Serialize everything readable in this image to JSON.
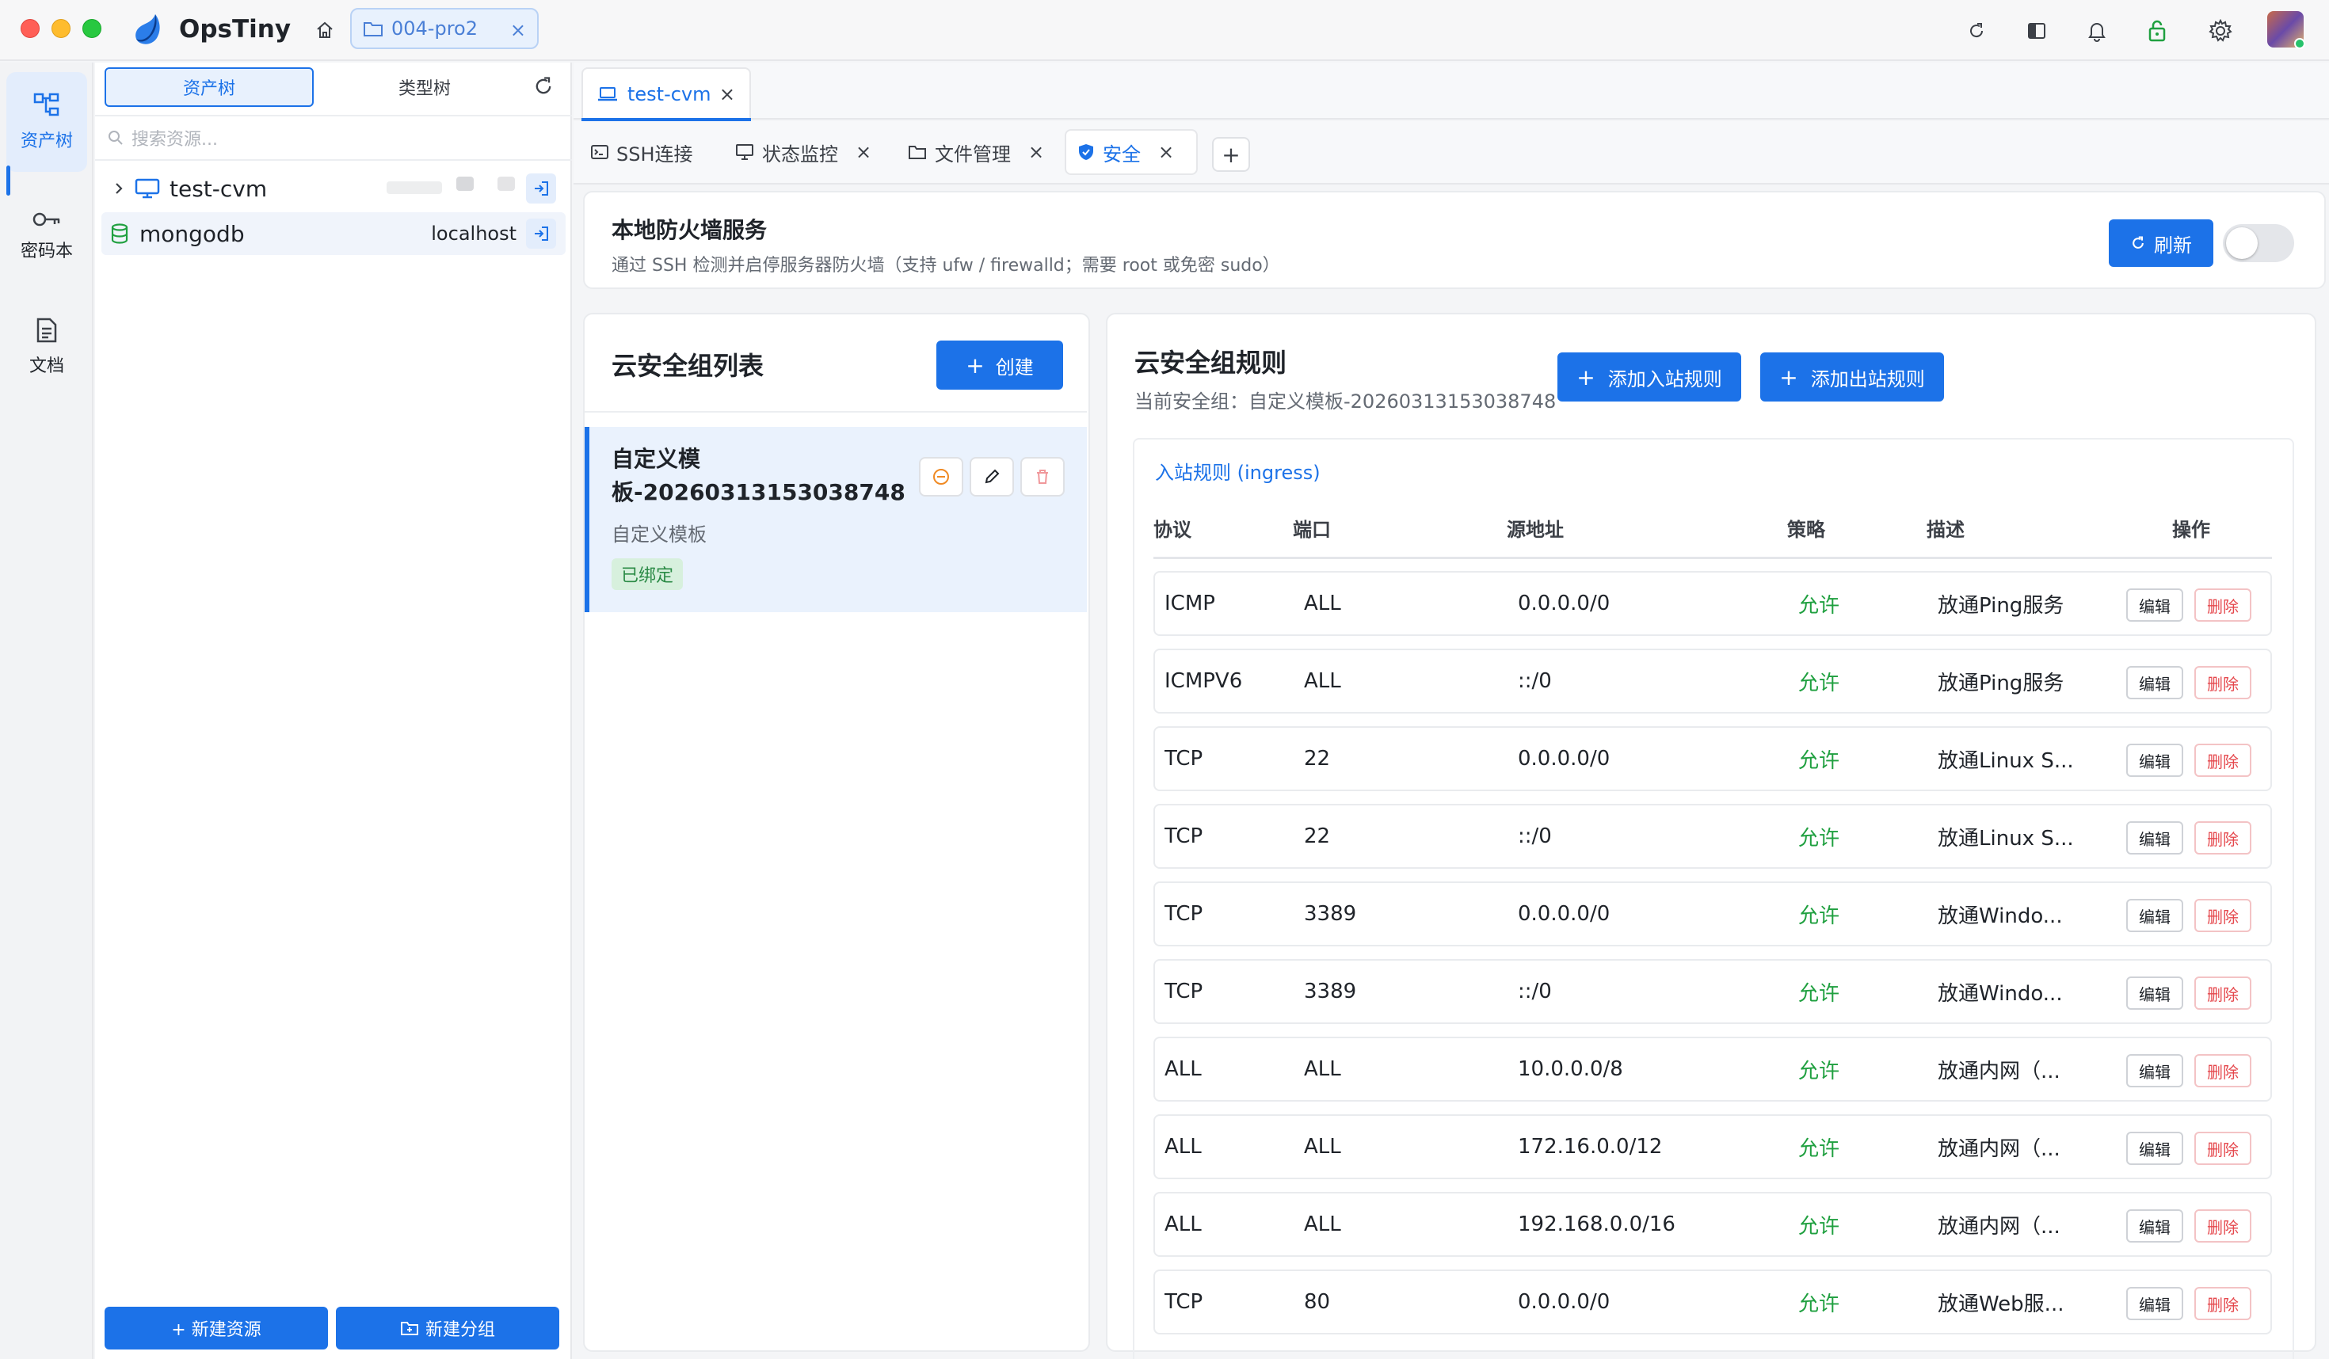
{
  "app": {
    "name": "OpsTiny",
    "workspace_tab": "004-pro2"
  },
  "rail": {
    "items": [
      {
        "label": "资产树"
      },
      {
        "label": "密码本"
      },
      {
        "label": "文档"
      }
    ]
  },
  "tree": {
    "segments": [
      "资产树",
      "类型树"
    ],
    "search_placeholder": "搜索资源...",
    "nodes": [
      {
        "name": "test-cvm",
        "host": ""
      },
      {
        "name": "mongodb",
        "host": "localhost"
      }
    ],
    "new_resource": "+ 新建资源",
    "new_group": "新建分组"
  },
  "file_tab": {
    "label": "test-cvm"
  },
  "sub_tabs": [
    {
      "label": "SSH连接"
    },
    {
      "label": "状态监控"
    },
    {
      "label": "文件管理"
    },
    {
      "label": "安全"
    }
  ],
  "firewall": {
    "title": "本地防火墙服务",
    "subtitle": "通过 SSH 检测并启停服务器防火墙（支持 ufw / firewalld；需要 root 或免密 sudo）",
    "refresh": "刷新",
    "enabled": false
  },
  "sg_list": {
    "title": "云安全组列表",
    "create": "创建",
    "items": [
      {
        "name": "自定义模板-20260313153038748",
        "desc": "自定义模板",
        "tag": "已绑定"
      }
    ]
  },
  "rules": {
    "title": "云安全组规则",
    "current": "当前安全组：自定义模板-20260313153038748",
    "add_in": "添加入站规则",
    "add_out": "添加出站规则",
    "ingress_title": "入站规则 (ingress)",
    "columns": [
      "协议",
      "端口",
      "源地址",
      "策略",
      "描述",
      "操作"
    ],
    "edit_label": "编辑",
    "delete_label": "删除",
    "rows": [
      {
        "protocol": "ICMP",
        "port": "ALL",
        "source": "0.0.0.0/0",
        "policy": "允许",
        "desc": "放通Ping服务"
      },
      {
        "protocol": "ICMPV6",
        "port": "ALL",
        "source": "::/0",
        "policy": "允许",
        "desc": "放通Ping服务"
      },
      {
        "protocol": "TCP",
        "port": "22",
        "source": "0.0.0.0/0",
        "policy": "允许",
        "desc": "放通Linux S..."
      },
      {
        "protocol": "TCP",
        "port": "22",
        "source": "::/0",
        "policy": "允许",
        "desc": "放通Linux S..."
      },
      {
        "protocol": "TCP",
        "port": "3389",
        "source": "0.0.0.0/0",
        "policy": "允许",
        "desc": "放通Windo..."
      },
      {
        "protocol": "TCP",
        "port": "3389",
        "source": "::/0",
        "policy": "允许",
        "desc": "放通Windo..."
      },
      {
        "protocol": "ALL",
        "port": "ALL",
        "source": "10.0.0.0/8",
        "policy": "允许",
        "desc": "放通内网（..."
      },
      {
        "protocol": "ALL",
        "port": "ALL",
        "source": "172.16.0.0/12",
        "policy": "允许",
        "desc": "放通内网（..."
      },
      {
        "protocol": "ALL",
        "port": "ALL",
        "source": "192.168.0.0/16",
        "policy": "允许",
        "desc": "放通内网（..."
      },
      {
        "protocol": "TCP",
        "port": "80",
        "source": "0.0.0.0/0",
        "policy": "允许",
        "desc": "放通Web服..."
      }
    ]
  },
  "colors": {
    "accent": "#1c72e8",
    "allow": "#20a040",
    "danger": "#e5484d",
    "tag_bg": "#d7f0dd"
  }
}
